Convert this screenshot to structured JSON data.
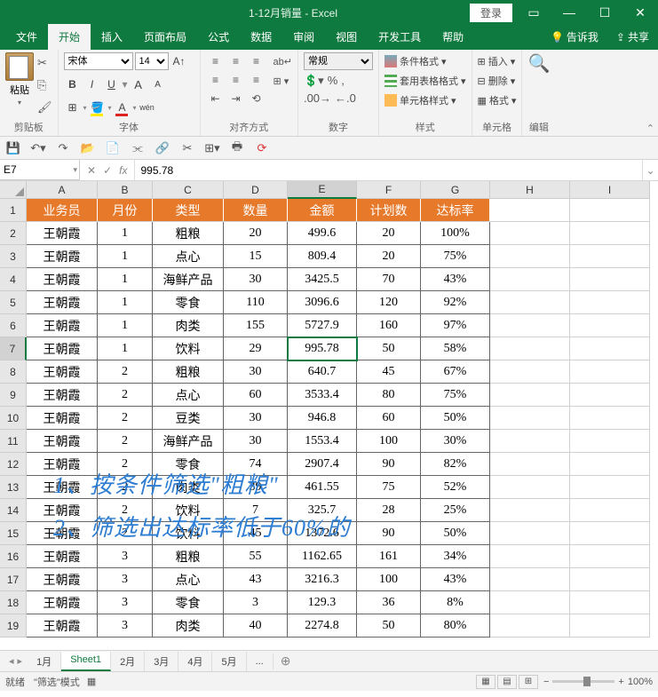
{
  "titlebar": {
    "title": "1-12月销量 - Excel",
    "login": "登录"
  },
  "tabs": {
    "items": [
      "文件",
      "开始",
      "插入",
      "页面布局",
      "公式",
      "数据",
      "审阅",
      "视图",
      "开发工具",
      "帮助"
    ],
    "tellme": "告诉我",
    "share": "共享"
  },
  "ribbon": {
    "clipboard": {
      "paste": "粘贴",
      "label": "剪贴板"
    },
    "font": {
      "name": "宋体",
      "size": "14",
      "label": "字体"
    },
    "align": {
      "wrap": "ab",
      "merge": "合并",
      "label": "对齐方式"
    },
    "number": {
      "format": "常规",
      "label": "数字"
    },
    "styles": {
      "cond": "条件格式",
      "table": "套用表格格式",
      "cell": "单元格样式",
      "label": "样式"
    },
    "cells": {
      "insert": "插入",
      "delete": "删除",
      "format": "格式",
      "label": "单元格"
    },
    "editing": {
      "label": "编辑"
    }
  },
  "fbar": {
    "name": "E7",
    "formula": "995.78"
  },
  "columns": [
    "A",
    "B",
    "C",
    "D",
    "E",
    "F",
    "G",
    "H",
    "I"
  ],
  "headers": [
    "业务员",
    "月份",
    "类型",
    "数量",
    "金额",
    "计划数",
    "达标率"
  ],
  "rows": [
    [
      "王朝霞",
      "1",
      "粗粮",
      "20",
      "499.6",
      "20",
      "100%"
    ],
    [
      "王朝霞",
      "1",
      "点心",
      "15",
      "809.4",
      "20",
      "75%"
    ],
    [
      "王朝霞",
      "1",
      "海鲜产品",
      "30",
      "3425.5",
      "70",
      "43%"
    ],
    [
      "王朝霞",
      "1",
      "零食",
      "110",
      "3096.6",
      "120",
      "92%"
    ],
    [
      "王朝霞",
      "1",
      "肉类",
      "155",
      "5727.9",
      "160",
      "97%"
    ],
    [
      "王朝霞",
      "1",
      "饮料",
      "29",
      "995.78",
      "50",
      "58%"
    ],
    [
      "王朝霞",
      "2",
      "粗粮",
      "30",
      "640.7",
      "45",
      "67%"
    ],
    [
      "王朝霞",
      "2",
      "点心",
      "60",
      "3533.4",
      "80",
      "75%"
    ],
    [
      "王朝霞",
      "2",
      "豆类",
      "30",
      "946.8",
      "60",
      "50%"
    ],
    [
      "王朝霞",
      "2",
      "海鲜产品",
      "30",
      "1553.4",
      "100",
      "30%"
    ],
    [
      "王朝霞",
      "2",
      "零食",
      "74",
      "2907.4",
      "90",
      "82%"
    ],
    [
      "王朝霞",
      "2",
      "肉类",
      "39",
      "461.55",
      "75",
      "52%"
    ],
    [
      "王朝霞",
      "2",
      "饮料",
      "7",
      "325.7",
      "28",
      "25%"
    ],
    [
      "王朝霞",
      "2",
      "饮料",
      "45",
      "1372.6",
      "90",
      "50%"
    ],
    [
      "王朝霞",
      "3",
      "粗粮",
      "55",
      "1162.65",
      "161",
      "34%"
    ],
    [
      "王朝霞",
      "3",
      "点心",
      "43",
      "3216.3",
      "100",
      "43%"
    ],
    [
      "王朝霞",
      "3",
      "零食",
      "3",
      "129.3",
      "36",
      "8%"
    ],
    [
      "王朝霞",
      "3",
      "肉类",
      "40",
      "2274.8",
      "50",
      "80%"
    ]
  ],
  "activeCell": {
    "row": 7,
    "col": 5
  },
  "overlay": {
    "line1": "1、按条件筛选\"粗粮\"",
    "line2": "2、筛选出达标率低于60%的"
  },
  "sheets": {
    "tabs": [
      "1月",
      "Sheet1",
      "2月",
      "3月",
      "4月",
      "5月"
    ],
    "more": "...",
    "active": 1
  },
  "status": {
    "ready": "就绪",
    "mode": "\"筛选\"模式",
    "zoom": "100%"
  }
}
